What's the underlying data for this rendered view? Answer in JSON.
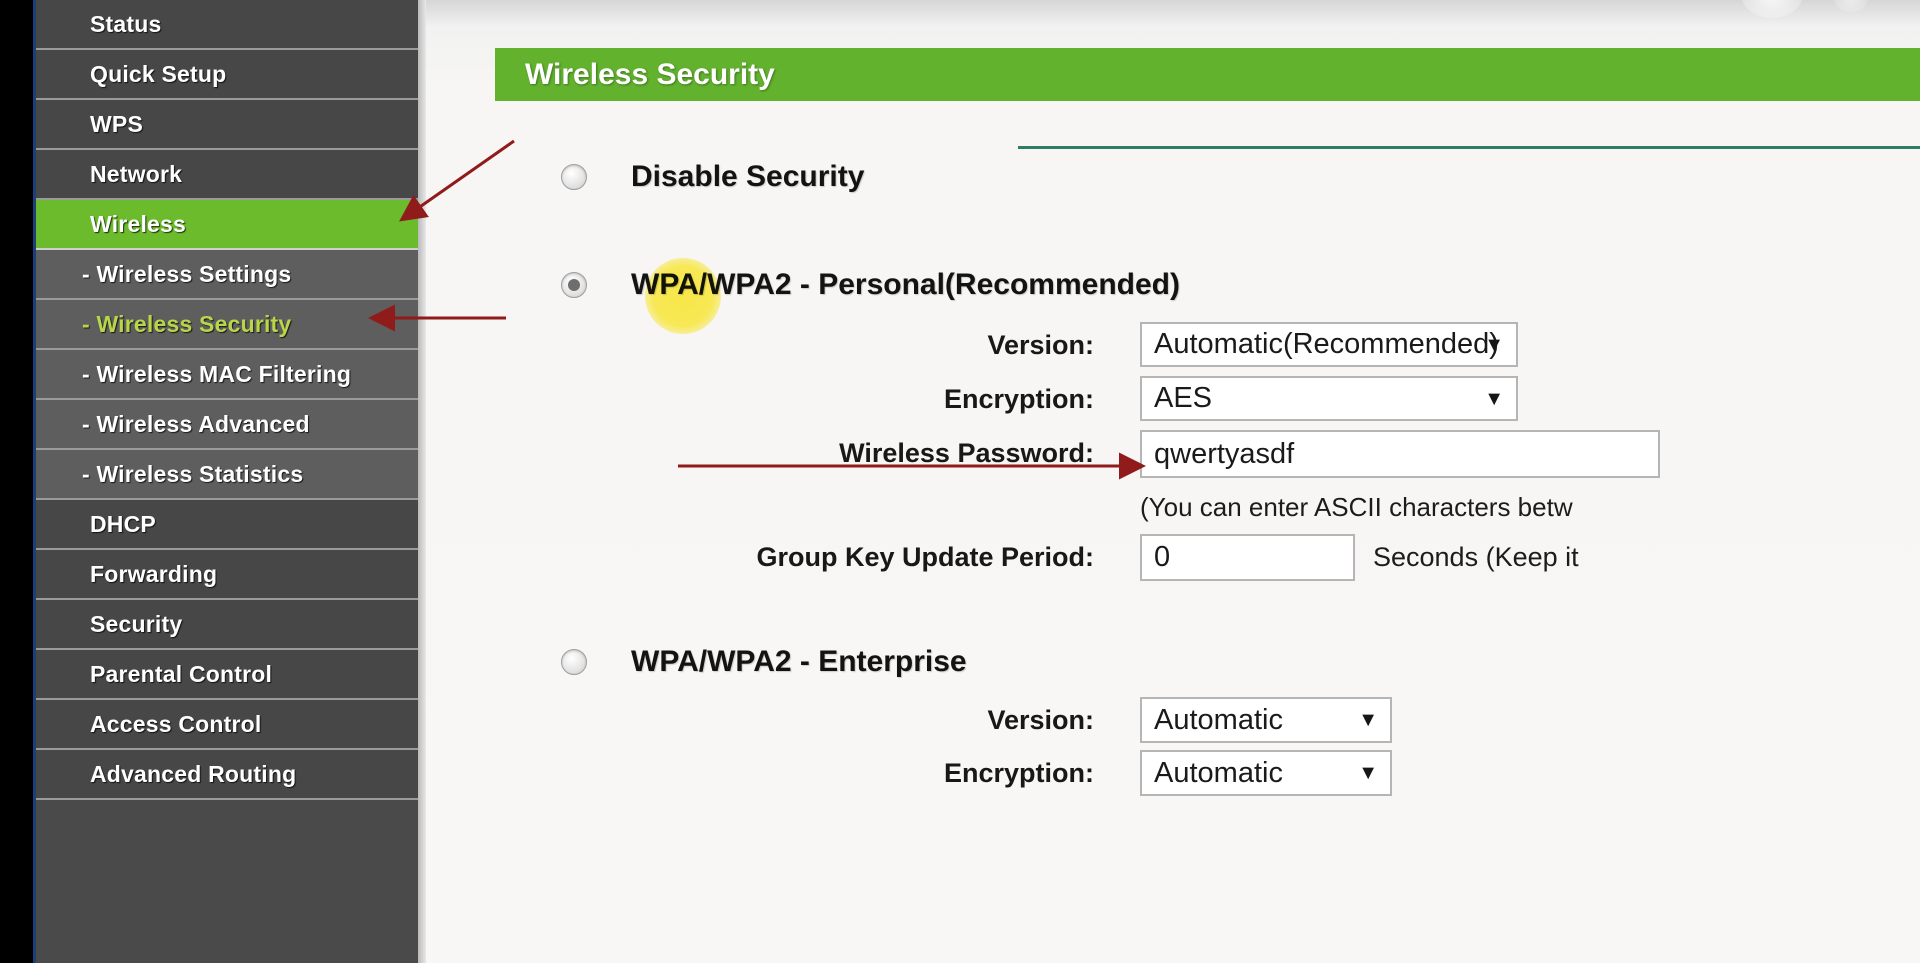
{
  "sidebar": {
    "items": [
      {
        "label": "Status",
        "type": "top",
        "state": "normal"
      },
      {
        "label": "Quick Setup",
        "type": "top",
        "state": "normal"
      },
      {
        "label": "WPS",
        "type": "top",
        "state": "normal"
      },
      {
        "label": "Network",
        "type": "top",
        "state": "normal"
      },
      {
        "label": "Wireless",
        "type": "top",
        "state": "active"
      },
      {
        "label": "- Wireless Settings",
        "type": "sub",
        "state": "normal"
      },
      {
        "label": "- Wireless Security",
        "type": "sub",
        "state": "current"
      },
      {
        "label": "- Wireless MAC Filtering",
        "type": "sub",
        "state": "normal"
      },
      {
        "label": "- Wireless Advanced",
        "type": "sub",
        "state": "normal"
      },
      {
        "label": "- Wireless Statistics",
        "type": "sub",
        "state": "normal"
      },
      {
        "label": "DHCP",
        "type": "top",
        "state": "normal"
      },
      {
        "label": "Forwarding",
        "type": "top",
        "state": "normal"
      },
      {
        "label": "Security",
        "type": "top",
        "state": "normal"
      },
      {
        "label": "Parental Control",
        "type": "top",
        "state": "normal"
      },
      {
        "label": "Access Control",
        "type": "top",
        "state": "normal"
      },
      {
        "label": "Advanced Routing",
        "type": "top",
        "state": "normal"
      }
    ]
  },
  "page": {
    "banner_title": "Wireless Security"
  },
  "security_options": {
    "disable": {
      "label": "Disable Security",
      "selected": false
    },
    "personal": {
      "label": "WPA/WPA2 - Personal(Recommended)",
      "selected": true,
      "version_label": "Version:",
      "version_value": "Automatic(Recommended)",
      "encryption_label": "Encryption:",
      "encryption_value": "AES",
      "password_label": "Wireless Password:",
      "password_value": "qwertyasdf",
      "password_hint": "(You can enter ASCII characters betw",
      "group_key_label": "Group Key Update Period:",
      "group_key_value": "0",
      "group_key_suffix": "Seconds (Keep it"
    },
    "enterprise": {
      "label": "WPA/WPA2 - Enterprise",
      "selected": false,
      "version_label": "Version:",
      "version_value": "Automatic",
      "encryption_label": "Encryption:",
      "encryption_value": "Automatic"
    }
  },
  "icons": {
    "caret": "▼"
  },
  "colors": {
    "accent_green": "#62b22e",
    "sidebar_active": "#6cbb2c",
    "sub_current_text": "#b9d64a",
    "rule": "#2e7d66",
    "annotation_red": "#8f1b1b",
    "highlight_yellow": "#ffee3c"
  }
}
